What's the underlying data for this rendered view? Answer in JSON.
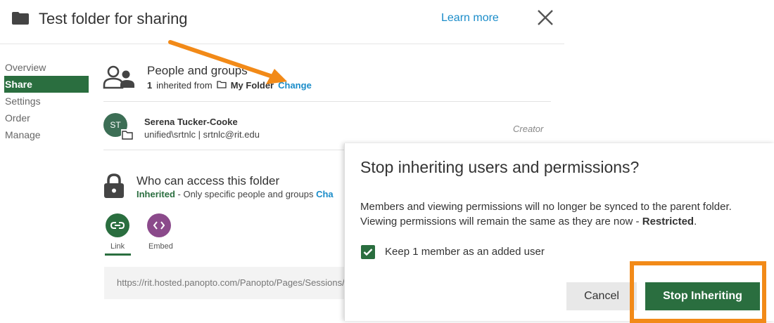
{
  "header": {
    "title": "Test folder for sharing",
    "learn_more": "Learn more",
    "folder_icon": "folder-icon",
    "close_icon": "close-icon"
  },
  "sidebar": {
    "items": [
      {
        "label": "Overview",
        "active": false
      },
      {
        "label": "Share",
        "active": true
      },
      {
        "label": "Settings",
        "active": false
      },
      {
        "label": "Order",
        "active": false
      },
      {
        "label": "Manage",
        "active": false
      }
    ]
  },
  "people": {
    "title": "People and groups",
    "count": "1",
    "inherited_from": "inherited from",
    "folder_name": "My Folder",
    "change": "Change",
    "icon": "people-icon"
  },
  "member": {
    "initials": "ST",
    "name": "Serena Tucker-Cooke",
    "details": "unified\\srtnlc | srtnlc@rit.edu",
    "role": "Creator"
  },
  "access": {
    "title": "Who can access this folder",
    "status": "Inherited",
    "description": " - Only specific people and groups ",
    "change_partial": "Cha",
    "icon": "lock-icon"
  },
  "share_options": {
    "link_label": "Link",
    "embed_label": "Embed"
  },
  "url": {
    "value": "https://rit.hosted.panopto.com/Panopto/Pages/Sessions/"
  },
  "dialog": {
    "title": "Stop inheriting users and permissions?",
    "body_line1": "Members and viewing permissions will no longer be synced to the parent folder.",
    "body_line2_prefix": "Viewing permissions will remain the same as they are now - ",
    "body_line2_bold": "Restricted",
    "body_line2_suffix": ".",
    "checkbox_label": "Keep 1 member as an added user",
    "checkbox_checked": true,
    "cancel": "Cancel",
    "stop": "Stop Inheriting"
  },
  "colors": {
    "accent_green": "#2a6e3f",
    "link_blue": "#1a8cc9",
    "annotation_orange": "#f28a18",
    "embed_purple": "#8b4a8b"
  }
}
